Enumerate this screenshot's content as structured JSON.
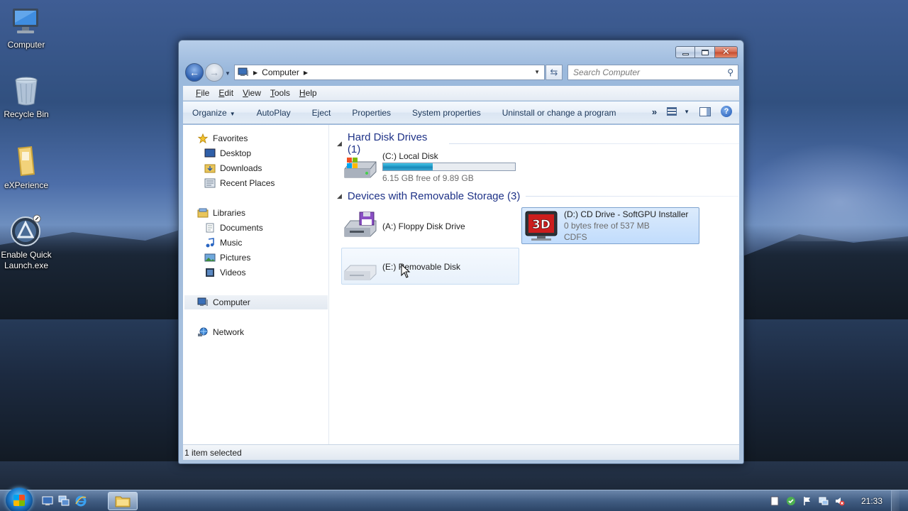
{
  "desktop": {
    "icons": [
      {
        "label": "Computer"
      },
      {
        "label": "Recycle Bin"
      },
      {
        "label": "eXPerience"
      },
      {
        "label": "Enable Quick Launch.exe"
      }
    ]
  },
  "window": {
    "address": {
      "location": "Computer"
    },
    "search": {
      "placeholder": "Search Computer"
    },
    "menu": [
      {
        "accel": "F",
        "rest": "ile"
      },
      {
        "accel": "E",
        "rest": "dit"
      },
      {
        "accel": "V",
        "rest": "iew"
      },
      {
        "accel": "T",
        "rest": "ools"
      },
      {
        "accel": "H",
        "rest": "elp"
      }
    ],
    "toolbar": {
      "organize": "Organize",
      "autoplay": "AutoPlay",
      "eject": "Eject",
      "properties": "Properties",
      "system_properties": "System properties",
      "uninstall": "Uninstall or change a program"
    },
    "nav": {
      "favorites": "Favorites",
      "desktop": "Desktop",
      "downloads": "Downloads",
      "recent": "Recent Places",
      "libraries": "Libraries",
      "documents": "Documents",
      "music": "Music",
      "pictures": "Pictures",
      "videos": "Videos",
      "computer": "Computer",
      "network": "Network"
    },
    "groups": {
      "hdd": "Hard Disk Drives (1)",
      "removable": "Devices with Removable Storage (3)"
    },
    "drives": {
      "c": {
        "name": "(C:) Local Disk",
        "free": "6.15 GB free of 9.89 GB",
        "used_fraction": 0.378
      },
      "a": {
        "name": "(A:) Floppy Disk Drive"
      },
      "d": {
        "name": "(D:) CD Drive - SoftGPU Installer",
        "free": "0 bytes free of 537 MB",
        "fs": "CDFS",
        "icon_text": "3D"
      },
      "e": {
        "name": "(E:) Removable Disk"
      }
    },
    "status": "1 item selected"
  },
  "taskbar": {
    "clock": "21:33"
  }
}
